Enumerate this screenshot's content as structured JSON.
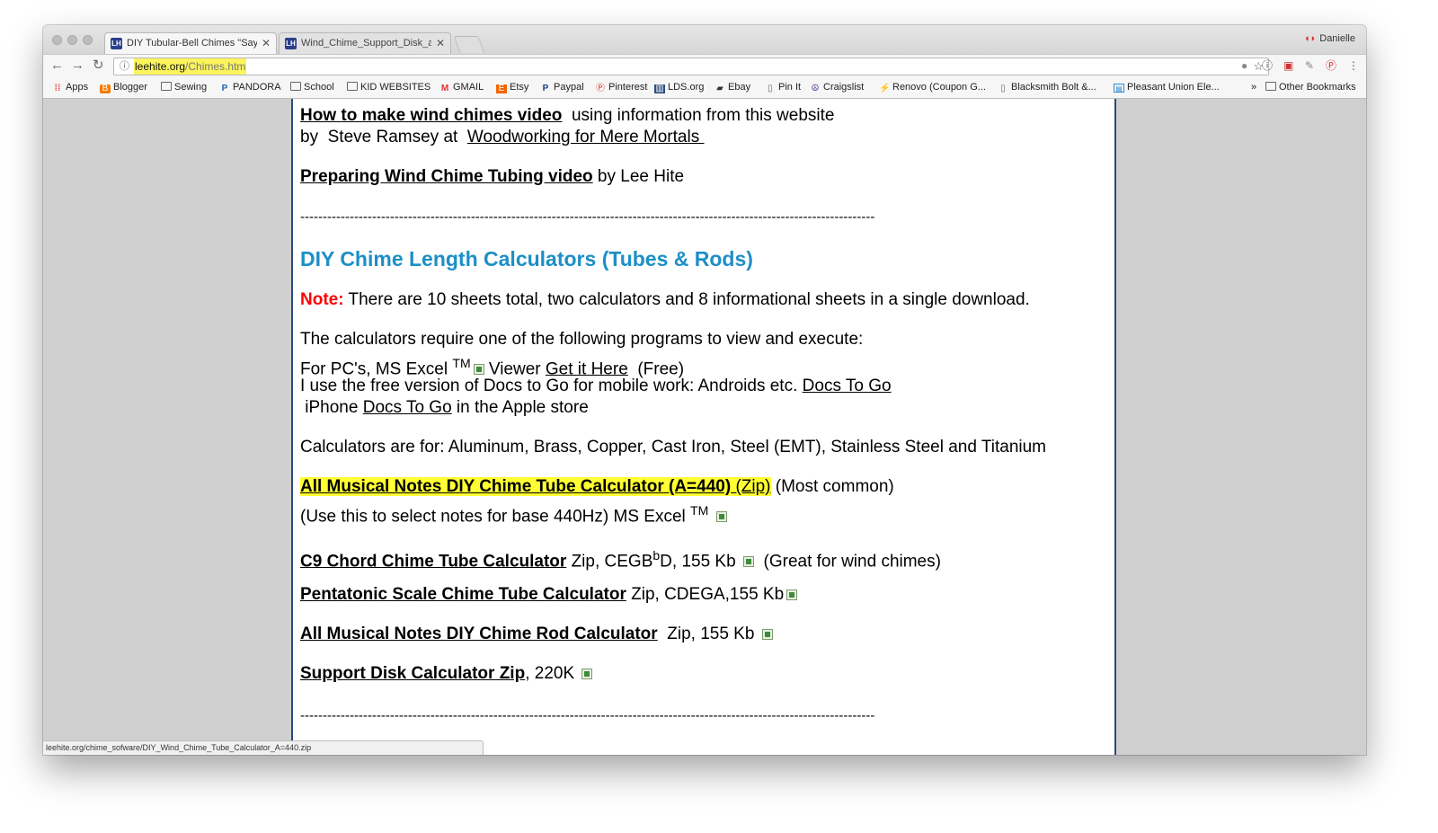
{
  "tabs": [
    {
      "title": "DIY Tubular-Bell Chimes \"Say",
      "active": true
    },
    {
      "title": "Wind_Chime_Support_Disk_a",
      "active": false
    }
  ],
  "profile_name": "Danielle",
  "address": {
    "host": "leehite.org",
    "path": "/Chimes.htm"
  },
  "bookmarks": [
    "Apps",
    "Blogger",
    "Sewing",
    "PANDORA",
    "School",
    "KID WEBSITES",
    "GMAIL",
    "Etsy",
    "Paypal",
    "Pinterest",
    "LDS.org",
    "Ebay",
    "Pin It",
    "Craigslist",
    "Renovo (Coupon G...",
    "Blacksmith Bolt &...",
    "Pleasant Union Ele...",
    "»",
    "Other Bookmarks"
  ],
  "page": {
    "video1_link": "How to make wind chimes video",
    "video1_text": "  using information from this website",
    "video1_by": "by  Steve Ramsey at  ",
    "video1_by_link": "Woodworking for Mere Mortals ",
    "video2_link": "Preparing Wind Chime Tubing video",
    "video2_text": " by Lee Hite",
    "divider": "--------------------------------------------------------------------------------------------------------------------------------",
    "heading": "DIY Chime Length Calculators (Tubes & Rods)",
    "note_label": "Note:",
    "note_text": " There are 10 sheets total, two calculators and 8 informational sheets in a single download.",
    "req_line": "The calculators require one of the following programs to view and execute:",
    "pc_prefix": "For PC's, MS Excel ",
    "tm": "TM",
    "pc_viewer": " Viewer ",
    "pc_link": "Get it Here",
    "pc_free": "  (Free)",
    "mobile_text": "I use the free version of Docs to Go for mobile work: Androids etc. ",
    "mobile_link": "Docs To Go",
    "iphone_prefix": " iPhone ",
    "iphone_link": "Docs To Go",
    "iphone_suffix": " in the Apple store",
    "materials": "Calculators are for: Aluminum, Brass, Copper, Cast Iron, Steel (EMT), Stainless Steel and Titanium",
    "calc1_link": "All Musical Notes DIY Chime Tube Calculator (A=440)",
    "calc1_zip": " (Zip)",
    "calc1_common": " (Most common)",
    "calc1_sub": "(Use this to select notes for base 440Hz) MS Excel ",
    "calc2_link": "C9 Chord Chime Tube Calculator",
    "calc2_text_a": " Zip, CEGB",
    "calc2_sup": "b",
    "calc2_text_b": "D, 155 Kb ",
    "calc2_note": "  (Great for wind chimes)",
    "calc3_link": "Pentatonic Scale Chime Tube Calculator",
    "calc3_text": " Zip, CDEGA,155 Kb",
    "calc4_link": "All Musical Notes DIY Chime Rod Calculator",
    "calc4_text": "  Zip, 155 Kb ",
    "calc5_link": "Support Disk Calculator Zip",
    "calc5_text": ", 220K "
  },
  "status_url": "leehite.org/chime_sofware/DIY_Wind_Chime_Tube_Calculator_A=440.zip"
}
